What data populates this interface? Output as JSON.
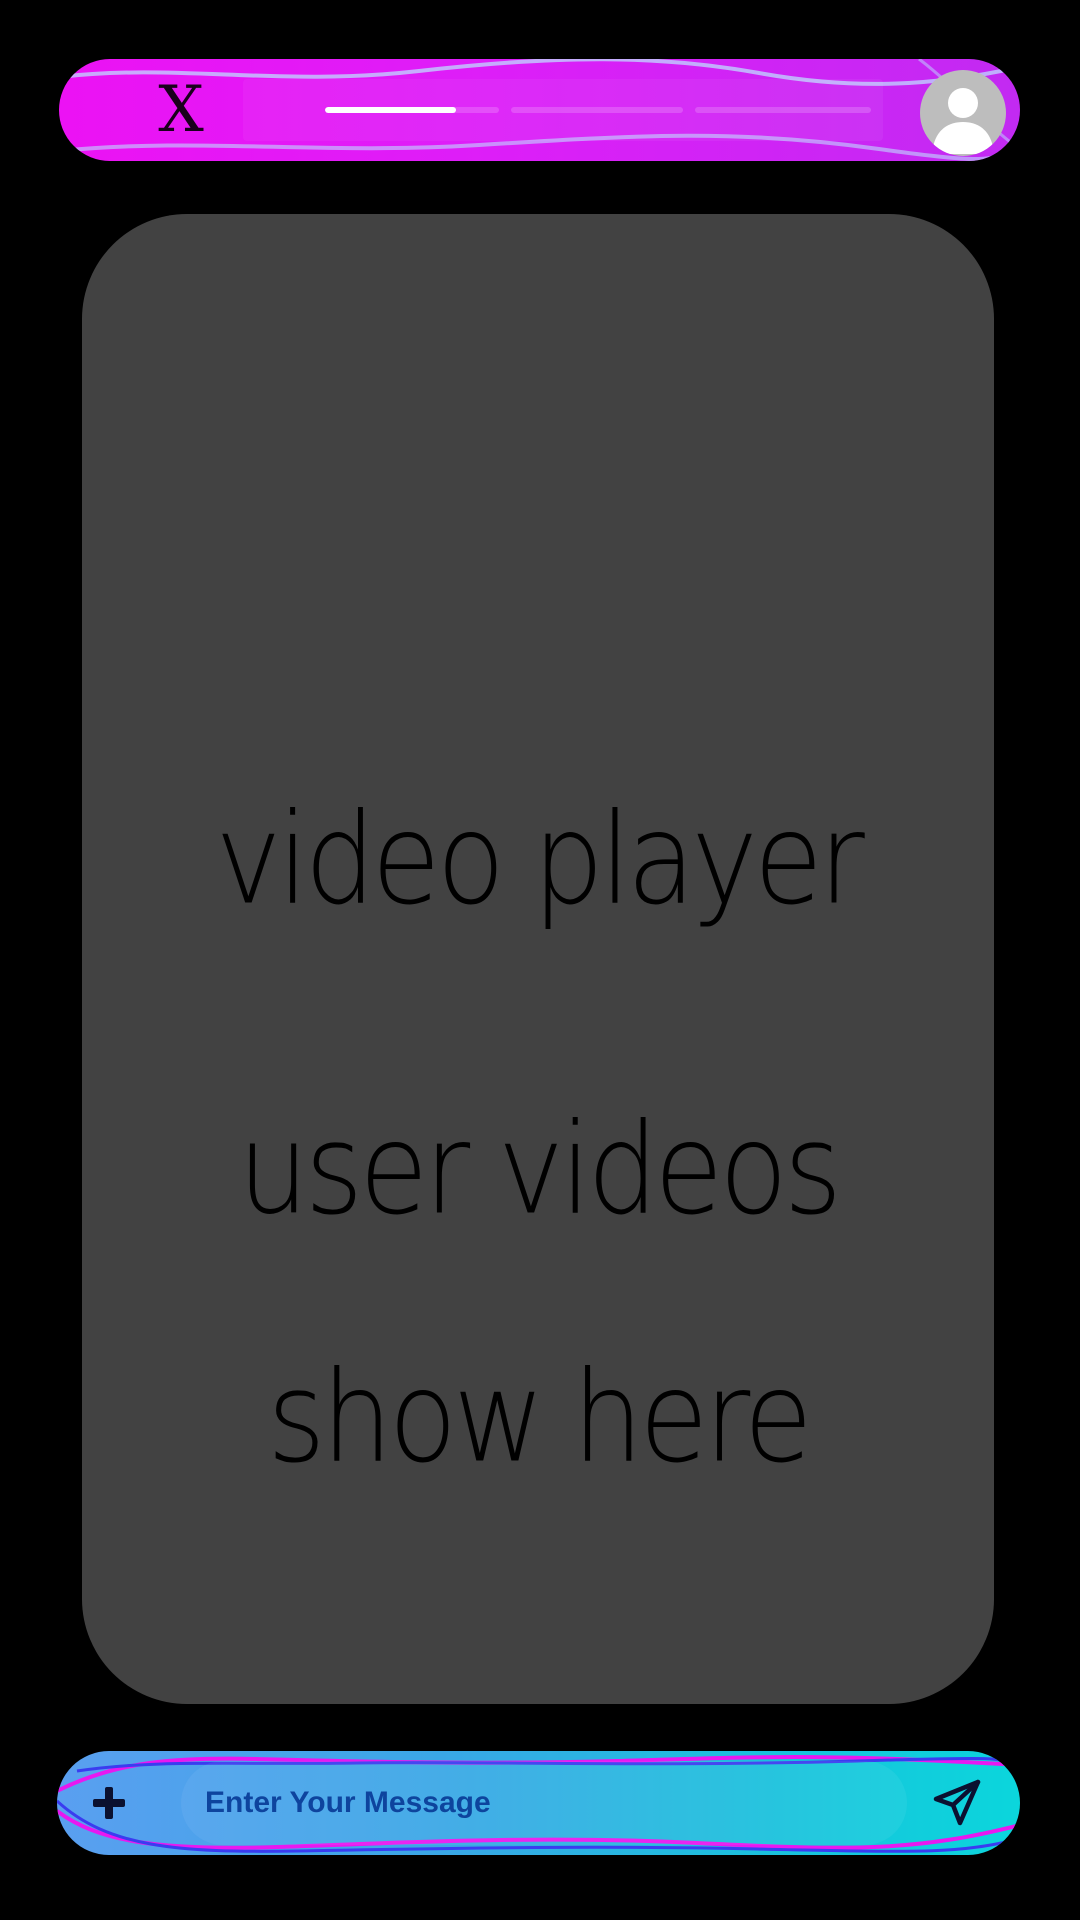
{
  "header": {
    "close_label": "X",
    "story_progress": [
      0.75,
      0,
      0
    ],
    "avatar_icon": "user-avatar-icon"
  },
  "video": {
    "line1": "video player",
    "line2": "user videos",
    "line3": "show here"
  },
  "composer": {
    "add_icon": "plus-icon",
    "placeholder": "Enter Your Message",
    "send_icon": "paper-plane-icon"
  },
  "colors": {
    "top_bar_gradient": [
      "#ec12f4",
      "#c22af2"
    ],
    "message_bar_gradient": [
      "#5a9ff0",
      "#0bd6dc"
    ],
    "video_card_bg": "#424242",
    "page_bg": "#000000"
  }
}
